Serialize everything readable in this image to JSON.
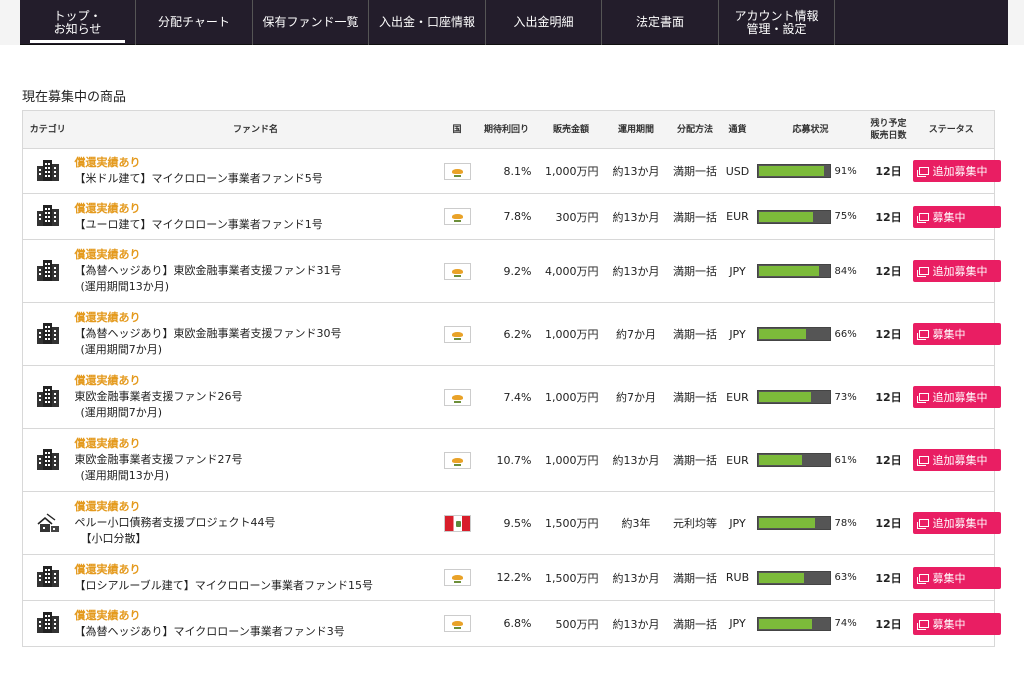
{
  "nav": [
    {
      "label": "トップ・\nお知らせ",
      "width": 116,
      "active": true
    },
    {
      "label": "分配チャート",
      "width": 117
    },
    {
      "label": "保有ファンド一覧",
      "width": 116
    },
    {
      "label": "入出金・口座情報",
      "width": 117
    },
    {
      "label": "入出金明細",
      "width": 116
    },
    {
      "label": "法定書面",
      "width": 117
    },
    {
      "label": "アカウント情報\n管理・設定",
      "width": 116
    },
    {
      "label": "",
      "width": 173
    }
  ],
  "section_title": "現在募集中の商品",
  "headers": {
    "category": "カテゴリ",
    "fund_name": "ファンド名",
    "country": "国",
    "yield": "期待利回り",
    "amount": "販売金額",
    "period": "運用期間",
    "distribution": "分配方法",
    "currency": "通貨",
    "application": "応募状況",
    "remaining": "残り予定\n販売日数",
    "status": "ステータス"
  },
  "funds": [
    {
      "icon": "building",
      "tag": "償還実績あり",
      "name": "【米ドル建て】マイクロローン事業者ファンド5号",
      "sub": "",
      "flag": "cy",
      "yield": "8.1%",
      "amount": "1,000万円",
      "period": "約13か月",
      "dist": "満期一括",
      "currency": "USD",
      "progress": 91,
      "progress_label": "91%",
      "days": "12日",
      "status": "追加募集中"
    },
    {
      "icon": "building",
      "tag": "償還実績あり",
      "name": "【ユーロ建て】マイクロローン事業者ファンド1号",
      "sub": "",
      "flag": "cy",
      "yield": "7.8%",
      "amount": "300万円",
      "period": "約13か月",
      "dist": "満期一括",
      "currency": "EUR",
      "progress": 75,
      "progress_label": "75%",
      "days": "12日",
      "status": "募集中"
    },
    {
      "icon": "building",
      "tag": "償還実績あり",
      "name": "【為替ヘッジあり】東欧金融事業者支援ファンド31号",
      "sub": "(運用期間13か月)",
      "flag": "cy",
      "yield": "9.2%",
      "amount": "4,000万円",
      "period": "約13か月",
      "dist": "満期一括",
      "currency": "JPY",
      "progress": 84,
      "progress_label": "84%",
      "days": "12日",
      "status": "追加募集中"
    },
    {
      "icon": "building",
      "tag": "償還実績あり",
      "name": "【為替ヘッジあり】東欧金融事業者支援ファンド30号",
      "sub": "(運用期間7か月)",
      "flag": "cy",
      "yield": "6.2%",
      "amount": "1,000万円",
      "period": "約7か月",
      "dist": "満期一括",
      "currency": "JPY",
      "progress": 66,
      "progress_label": "66%",
      "days": "12日",
      "status": "募集中"
    },
    {
      "icon": "building",
      "tag": "償還実績あり",
      "name": "東欧金融事業者支援ファンド26号",
      "sub": "(運用期間7か月)",
      "flag": "cy",
      "yield": "7.4%",
      "amount": "1,000万円",
      "period": "約7か月",
      "dist": "満期一括",
      "currency": "EUR",
      "progress": 73,
      "progress_label": "73%",
      "days": "12日",
      "status": "追加募集中"
    },
    {
      "icon": "building",
      "tag": "償還実績あり",
      "name": "東欧金融事業者支援ファンド27号",
      "sub": "(運用期間13か月)",
      "flag": "cy",
      "yield": "10.7%",
      "amount": "1,000万円",
      "period": "約13か月",
      "dist": "満期一括",
      "currency": "EUR",
      "progress": 61,
      "progress_label": "61%",
      "days": "12日",
      "status": "追加募集中"
    },
    {
      "icon": "house",
      "tag": "償還実績あり",
      "name": "ペルー小口債務者支援プロジェクト44号",
      "sub": "【小口分散】",
      "flag": "pe",
      "yield": "9.5%",
      "amount": "1,500万円",
      "period": "約3年",
      "dist": "元利均等",
      "currency": "JPY",
      "progress": 78,
      "progress_label": "78%",
      "days": "12日",
      "status": "追加募集中"
    },
    {
      "icon": "building",
      "tag": "償還実績あり",
      "name": "【ロシアルーブル建て】マイクロローン事業者ファンド15号",
      "sub": "",
      "flag": "cy",
      "yield": "12.2%",
      "amount": "1,500万円",
      "period": "約13か月",
      "dist": "満期一括",
      "currency": "RUB",
      "progress": 63,
      "progress_label": "63%",
      "days": "12日",
      "status": "募集中"
    },
    {
      "icon": "building",
      "tag": "償還実績あり",
      "name": "【為替ヘッジあり】マイクロローン事業者ファンド3号",
      "sub": "",
      "flag": "cy",
      "yield": "6.8%",
      "amount": "500万円",
      "period": "約13か月",
      "dist": "満期一括",
      "currency": "JPY",
      "progress": 74,
      "progress_label": "74%",
      "days": "12日",
      "status": "募集中"
    }
  ]
}
